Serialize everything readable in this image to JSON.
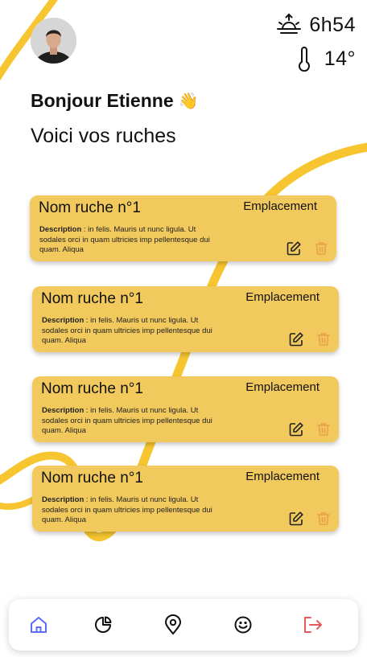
{
  "header": {
    "sunrise_time": "6h54",
    "temperature": "14°"
  },
  "greeting": {
    "hello": "Bonjour Etienne",
    "wave_emoji": "👋",
    "subtitle": "Voici vos ruches"
  },
  "hives": [
    {
      "name": "Nom ruche n°1",
      "location_label": "Emplacement",
      "description_label": "Description",
      "description_text": " : in felis. Mauris ut nunc ligula. Ut sodales orci in quam ultricies imp pellentesque dui quam. Aliqua"
    },
    {
      "name": "Nom ruche n°1",
      "location_label": "Emplacement",
      "description_label": "Description",
      "description_text": " : in felis. Mauris ut nunc ligula. Ut sodales orci in quam ultricies imp pellentesque dui quam. Aliqua"
    },
    {
      "name": "Nom ruche n°1",
      "location_label": "Emplacement",
      "description_label": "Description",
      "description_text": " : in felis. Mauris ut nunc ligula. Ut sodales orci in quam ultricies imp pellentesque dui quam. Aliqua"
    },
    {
      "name": "Nom ruche n°1",
      "location_label": "Emplacement",
      "description_label": "Description",
      "description_text": " : in felis. Mauris ut nunc ligula. Ut sodales orci in quam ultricies imp pellentesque dui quam. Aliqua"
    }
  ],
  "icons": {
    "sunrise": "sunrise-icon",
    "temperature": "thermometer-icon",
    "edit": "edit-icon",
    "delete": "trash-icon",
    "nav_home": "home-icon",
    "nav_stats": "pie-chart-icon",
    "nav_map": "map-pin-icon",
    "nav_profile": "smiley-icon",
    "nav_logout": "logout-icon"
  },
  "colors": {
    "accent_yellow": "#f2c95c",
    "ribbon": "#f7c52f",
    "nav_active": "#5b6cff",
    "logout": "#e8585a",
    "trash": "#e9a04a"
  }
}
